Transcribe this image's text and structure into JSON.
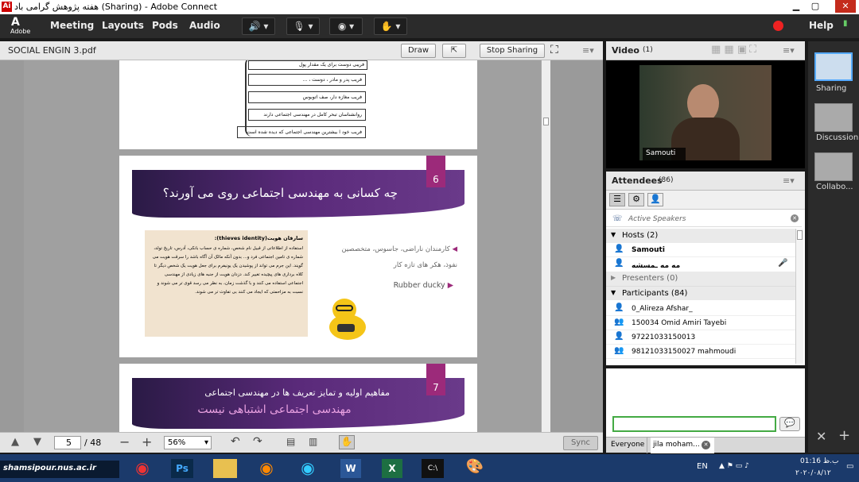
{
  "window": {
    "title": "هفته پژوهش گرامی باد (Sharing) - Adobe Connect",
    "logo": "Ai"
  },
  "menu": {
    "logo_label": "Adobe",
    "items": [
      "Meeting",
      "Layouts",
      "Pods",
      "Audio"
    ],
    "help": "Help"
  },
  "share": {
    "filename": "SOCIAL ENGIN 3.pdf",
    "draw": "Draw",
    "stop_sharing": "Stop Sharing",
    "page": "5",
    "total": "/ 48",
    "zoom": "56%",
    "sync": "Sync"
  },
  "slide5": {
    "items": [
      "فریبی دوست برای یک مقدار پول",
      "فریب پدر و مادر ، دوست ، ...",
      "فریب مغازه دار، صف اتوبوس",
      "روانشناسان تبحر کامل در مهندسی اجتماعی دارند",
      "فریب خود ا بیشترین مهندسی اجتماعی که دیده شده است"
    ]
  },
  "slide6": {
    "num": "6",
    "title": "چه کسانی به مهندسی اجتماعی روی می آورند؟",
    "box_title": "سارقان هویت(thieves identity):",
    "box_text": "استفاده از اطلاعاتی از قبیل نام شخص، شماره ی حساب بانکی، آدرس، تاریخ تولد، شماره ی تامین اجتماعی فرد و... بدون آنکه مالک آن آگاه باشد را سرقت هویت می گویند. این جرم می تواند از پوشیدن یک یونیفرم برای جعل هویت یک شخص دیگر تا کلاه برداری های پیچیده تغییر کند. دزدان هویت از جنبه های زیادی از مهندسی اجتماعی استفاده می کنند و با گذشت زمان، به نظر می رسد قوی تر می شوند و نسبت به مزاحمتی که ایجاد می کنند بی تفاوت تر می شوند.",
    "bullet1": "کارمندان ناراضی، جاسوس، متخصصین نفوذ، هکر های تازه کار",
    "bullet2": "Rubber ducky"
  },
  "slide7": {
    "num": "7",
    "title": "مفاهیم اولیه و تمایز تعریف ها در مهندسی اجتماعی",
    "subtitle": "مهندسی اجتماعی اشتباهی نیست"
  },
  "video": {
    "title": "Video",
    "count": "(1)",
    "name": "Samouti"
  },
  "attendees": {
    "title": "Attendees",
    "count": "(86)",
    "active": "Active Speakers",
    "hosts": "Hosts (2)",
    "host1": "Samouti",
    "host2": "مه مه ـمسشه",
    "presenters": "Presenters (0)",
    "participants": "Participants (84)",
    "people": [
      "0_Alireza Afshar_",
      "150034 Omid Amiri Tayebi",
      "97221033150013",
      "98121033150027 mahmoudi"
    ]
  },
  "chat": {
    "everyone": "Everyone",
    "private": "jila moham..."
  },
  "layouts": [
    "Sharing",
    "Discussion",
    "Collabo..."
  ],
  "taskbar": {
    "site": "shamsipour.nus.ac.ir",
    "lang": "EN",
    "time": "01:16 ب.ظ",
    "date": "۲۰۲۰/۰۸/۱۲"
  }
}
